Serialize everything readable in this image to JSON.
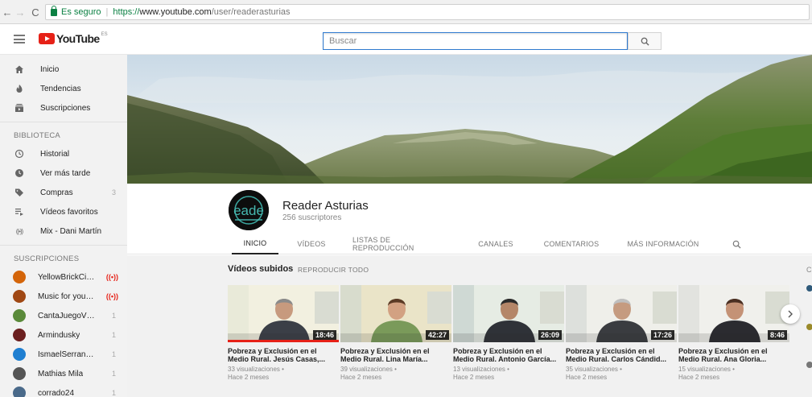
{
  "browser": {
    "secure_label": "Es seguro",
    "url_scheme": "https://",
    "url_host": "www.youtube.com",
    "url_path": "/user/readerasturias"
  },
  "masthead": {
    "logo_text": "YouTube",
    "country": "ES",
    "search_placeholder": "Buscar"
  },
  "sidebar": {
    "main": [
      {
        "label": "Inicio",
        "icon": "home-icon"
      },
      {
        "label": "Tendencias",
        "icon": "flame-icon"
      },
      {
        "label": "Suscripciones",
        "icon": "subscriptions-icon"
      }
    ],
    "library_heading": "BIBLIOTECA",
    "library": [
      {
        "label": "Historial",
        "icon": "history-icon",
        "count": ""
      },
      {
        "label": "Ver más tarde",
        "icon": "clock-icon",
        "count": ""
      },
      {
        "label": "Compras",
        "icon": "tag-icon",
        "count": "3"
      },
      {
        "label": "Vídeos favoritos",
        "icon": "playlist-icon",
        "count": ""
      },
      {
        "label": "Mix - Dani Martín",
        "icon": "radio-icon",
        "count": ""
      }
    ],
    "subs_heading": "SUSCRIPCIONES",
    "subscriptions": [
      {
        "label": "YellowBrickCin...",
        "badge": "((•))",
        "color": "#d4650a"
      },
      {
        "label": "Music for your ...",
        "badge": "((•))",
        "color": "#a04814"
      },
      {
        "label": "CantaJuegoVEVO",
        "badge": "1",
        "color": "#5a8a3a"
      },
      {
        "label": "Armindusky",
        "badge": "1",
        "color": "#6b1f1f"
      },
      {
        "label": "IsmaelSerranoV...",
        "badge": "1",
        "color": "#1f7fd1"
      },
      {
        "label": "Mathias Mila",
        "badge": "1",
        "color": "#555555"
      },
      {
        "label": "corrado24",
        "badge": "1",
        "color": "#4a6a8a"
      }
    ]
  },
  "channel": {
    "name": "Reader Asturias",
    "subscribers": "256 suscriptores",
    "avatar_text": "eade",
    "tabs": [
      {
        "label": "INICIO",
        "active": true
      },
      {
        "label": "VÍDEOS",
        "active": false
      },
      {
        "label": "LISTAS DE REPRODUCCIÓN",
        "active": false
      },
      {
        "label": "CANALES",
        "active": false
      },
      {
        "label": "COMENTARIOS",
        "active": false
      },
      {
        "label": "MÁS INFORMACIÓN",
        "active": false
      }
    ]
  },
  "uploads": {
    "title": "Vídeos subidos",
    "play_all": "REPRODUCIR TODO",
    "videos": [
      {
        "title": "Pobreza y Exclusión en el Medio Rural. Jesús Casas,...",
        "views": "33 visualizaciones •",
        "age": "Hace 2 meses",
        "duration": "18:46"
      },
      {
        "title": "Pobreza y Exclusión en el Medio Rural. Lina María...",
        "views": "39 visualizaciones •",
        "age": "Hace 2 meses",
        "duration": "42:27"
      },
      {
        "title": "Pobreza y Exclusión en el Medio Rural. Antonio García...",
        "views": "13 visualizaciones •",
        "age": "Hace 2 meses",
        "duration": "26:09"
      },
      {
        "title": "Pobreza y Exclusión en el Medio Rural. Carlos Cándid...",
        "views": "35 visualizaciones •",
        "age": "Hace 2 meses",
        "duration": "17:26"
      },
      {
        "title": "Pobreza y Exclusión en el Medio Rural. Ana Gloria...",
        "views": "15 visualizaciones •",
        "age": "Hace 2 meses",
        "duration": "8:46"
      }
    ],
    "right_label": "C"
  }
}
